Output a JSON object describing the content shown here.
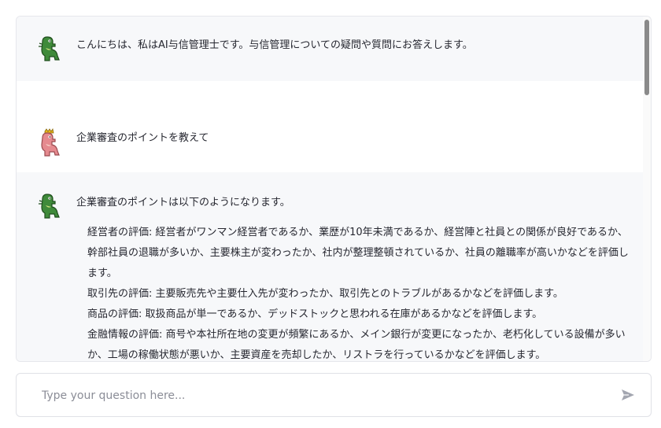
{
  "messages": [
    {
      "role": "assistant",
      "text": "こんにちは、私はAI与信管理士です。与信管理についての疑問や質問にお答えします。"
    },
    {
      "role": "user",
      "text": "企業審査のポイントを教えて"
    },
    {
      "role": "assistant",
      "text": "企業審査のポイントは以下のようになります。",
      "points": [
        "経営者の評価: 経営者がワンマン経営者であるか、業歴が10年未満であるか、経営陣と社員との関係が良好であるか、幹部社員の退職が多いか、主要株主が変わったか、社内が整理整頓されているか、社員の離職率が高いかなどを評価します。",
        "取引先の評価: 主要販売先や主要仕入先が変わったか、取引先とのトラブルがあるかなどを評価します。",
        "商品の評価: 取扱商品が単一であるか、デッドストックと思われる在庫があるかなどを評価します。",
        "金融情報の評価: 商号や本社所在地の変更が頻繁にあるか、メイン銀行が変更になったか、老朽化している設備が多いか、工場の稼働状態が悪いか、主要資産を売却したか、リストラを行っているかなどを評価します。"
      ]
    }
  ],
  "input": {
    "placeholder": "Type your question here..."
  },
  "icons": {
    "assistant_avatar": "green-dinosaur-icon",
    "user_avatar": "pink-dinosaur-crown-icon",
    "send": "send-arrow-icon"
  },
  "colors": {
    "assistant_avatar": "#3f8a3a",
    "user_avatar": "#e58a8f",
    "tint": "#f7f8fa"
  }
}
